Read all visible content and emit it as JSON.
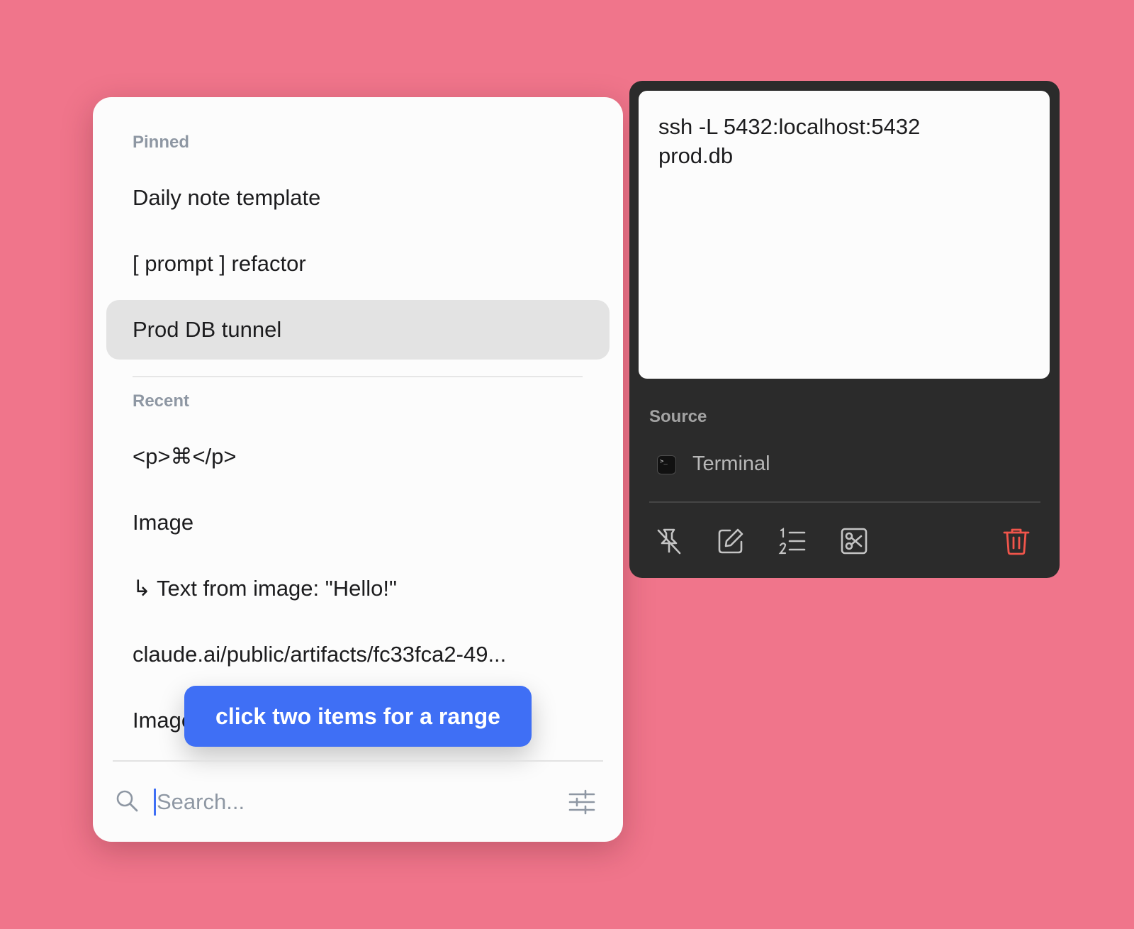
{
  "list": {
    "pinned_label": "Pinned",
    "pinned_items": [
      {
        "label": "Daily note template"
      },
      {
        "label": "[ prompt ] refactor"
      },
      {
        "label": "Prod DB tunnel",
        "selected": true
      }
    ],
    "recent_label": "Recent",
    "recent_items": [
      {
        "label": "<p>⌘</p>"
      },
      {
        "label": "Image"
      },
      {
        "label": "↳ Text from image: \"Hello!\""
      },
      {
        "label": "claude.ai/public/artifacts/fc33fca2-49..."
      },
      {
        "label": "Image"
      }
    ]
  },
  "toast": {
    "text": "click two items for a range"
  },
  "search": {
    "placeholder": "Search...",
    "value": ""
  },
  "detail": {
    "preview_text": "ssh -L 5432:localhost:5432\nprod.db",
    "source_label": "Source",
    "source_app": "Terminal",
    "terminal_glyph": ">_"
  },
  "icons": {
    "search": "search-icon",
    "filter": "sliders-icon",
    "unpin": "unpin-icon",
    "edit": "edit-icon",
    "numbered_list": "numbered-list-icon",
    "transform": "scissors-icon",
    "delete": "trash-icon"
  },
  "colors": {
    "background": "#f0758b",
    "accent": "#3f6ff5",
    "delete": "#f0554b",
    "selected_row": "#e3e3e3",
    "side_panel": "#2b2b2b"
  }
}
